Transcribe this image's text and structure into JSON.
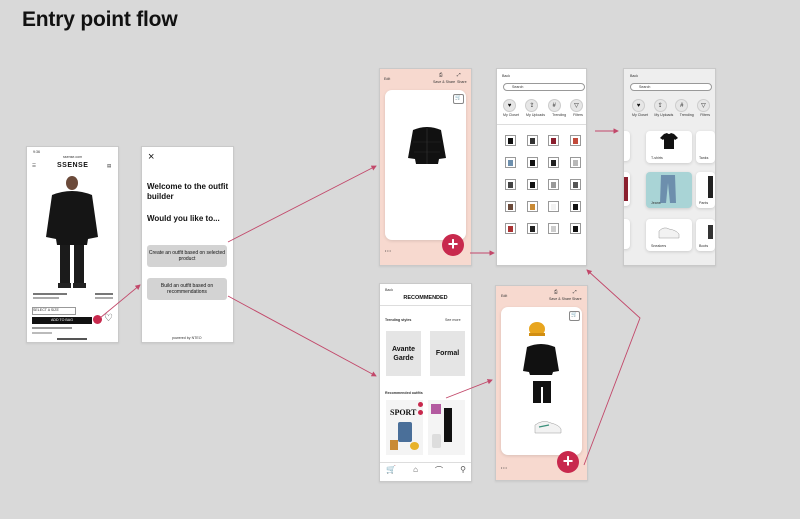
{
  "title": "Entry point flow",
  "colors": {
    "accent": "#c8294d",
    "peach": "#f7d9cf",
    "canvas": "#d9d9d9"
  },
  "product": {
    "status_time": "9:36",
    "url": "ssense.com",
    "brand": "SSENSE",
    "add_button": "ADD TO BAG",
    "size_label": "SELECT A SIZE"
  },
  "welcome": {
    "heading": "Welcome to the outfit builder",
    "question": "Would you like to...",
    "option1": "Create an outfit based on selected product",
    "option2": "Build an outfit based on recommendations",
    "powered": "powered by NTEO"
  },
  "builder": {
    "back": "Edit",
    "save_label": "Save & Share",
    "fullscreen_label": "Share"
  },
  "catalog": {
    "back": "Back",
    "search_placeholder": "Search",
    "filters": [
      {
        "label": "My Closet",
        "icon": "heart-icon",
        "glyph": "♥"
      },
      {
        "label": "My Uploads",
        "icon": "upload-icon",
        "glyph": "⇪"
      },
      {
        "label": "Trending",
        "icon": "hash-icon",
        "glyph": "#"
      },
      {
        "label": "Filters",
        "icon": "filter-icon",
        "glyph": "▽"
      }
    ]
  },
  "catalog2": {
    "categories": [
      "T-shirts",
      "Tanks",
      "Jeans",
      "Pants",
      "Sneakers",
      "Boots"
    ]
  },
  "recommended": {
    "back": "Back",
    "header": "RECOMMENDED",
    "trending_label": "Trending styles",
    "see_more": "See more",
    "style1": "Avante Garde",
    "style2": "Formal",
    "outfits_label": "Recommended outfits",
    "magazine": "SPORT"
  },
  "fab_glyph": "+"
}
